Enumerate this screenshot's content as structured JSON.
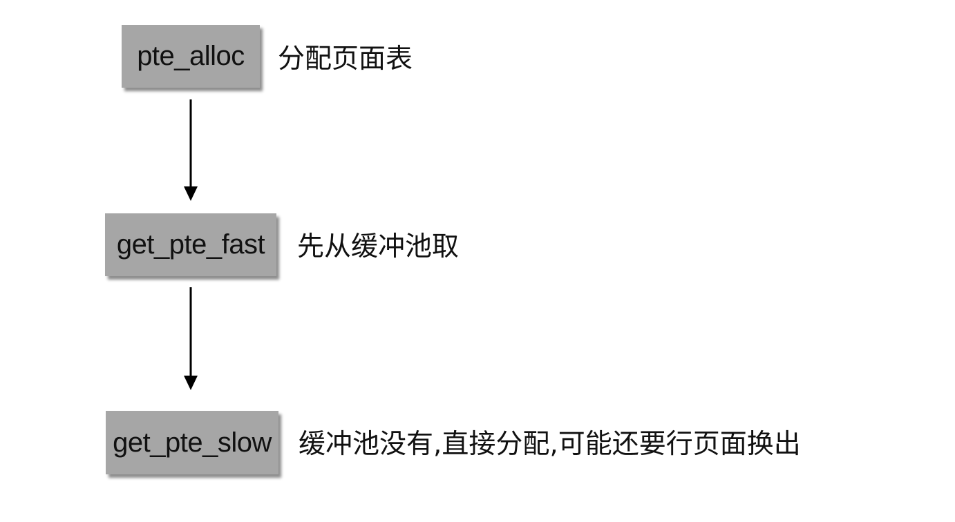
{
  "nodes": [
    {
      "label": "pte_alloc",
      "description": "分配页面表"
    },
    {
      "label": "get_pte_fast",
      "description": "先从缓冲池取"
    },
    {
      "label": "get_pte_slow",
      "description": "缓冲池没有,直接分配,可能还要行页面换出"
    }
  ],
  "colors": {
    "node_fill": "#a6a6a6",
    "text": "#111111",
    "arrow": "#000000"
  }
}
